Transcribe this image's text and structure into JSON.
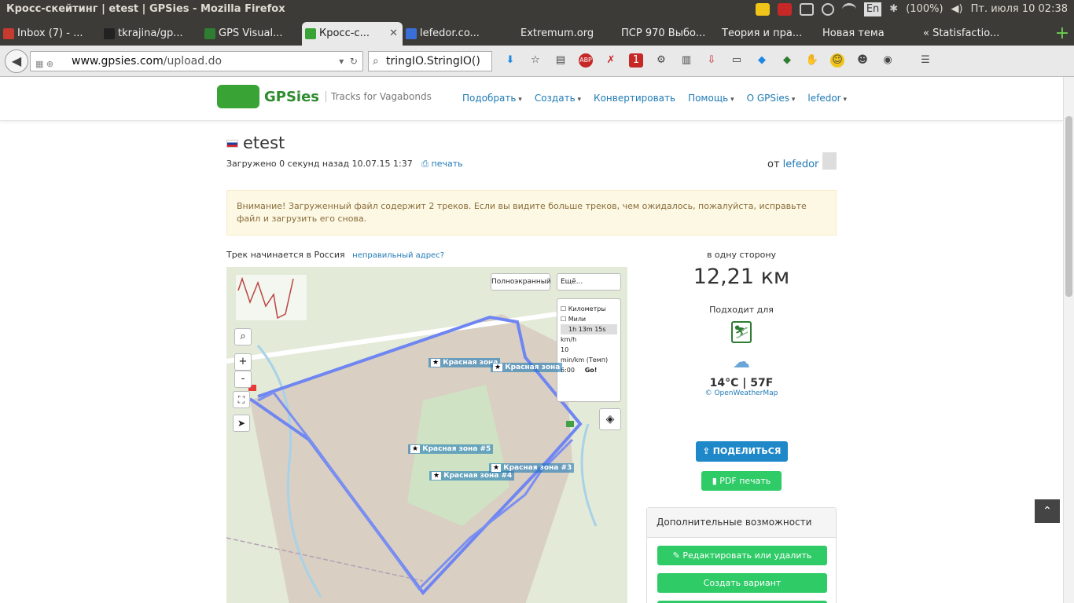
{
  "window": {
    "title": "Кросс-скейтинг | etest | GPSies - Mozilla Firefox"
  },
  "system": {
    "battery": "(100%)",
    "keyboard": "En",
    "clock": "Пт. июля 10 02:38"
  },
  "tabs": [
    {
      "label": "Inbox (7) - ...",
      "color": "#c63b2f"
    },
    {
      "label": "tkrajina/gp...",
      "color": "#222222"
    },
    {
      "label": "GPS Visual...",
      "color": "#2e7d32"
    },
    {
      "label": "Кросс-с...",
      "color": "#3aa335",
      "active": true
    },
    {
      "label": "lefedor.co...",
      "color": "#3a6fd8"
    },
    {
      "label": "Extremum.org",
      "color": ""
    },
    {
      "label": "ПСР 970 Выбо...",
      "color": ""
    },
    {
      "label": "Теория и пра...",
      "color": ""
    },
    {
      "label": "Новая тема",
      "color": ""
    },
    {
      "label": "« Statisfactio...",
      "color": ""
    }
  ],
  "nav": {
    "url_domain": "www.gpsies.com",
    "url_path": "/upload.do",
    "search_value": "tringIO.StringIO()"
  },
  "site": {
    "logo_name": "GPSies",
    "logo_tagline": "Tracks for Vagabonds",
    "menu": [
      "Подобрать",
      "Создать",
      "Конвертировать",
      "Помощь",
      "О GPSies",
      "lefedor"
    ]
  },
  "track": {
    "title": "etest",
    "uploaded": "Загружено 0 секунд назад 10.07.15 1:37",
    "print_label": "печать",
    "owner_prefix": "от",
    "owner": "lefedor"
  },
  "alert": {
    "text": "Внимание! Загруженный файл содержит 2 треков. Если вы видите больше треков, чем ожидалось, пожалуйста, исправьте файл и загрузить его снова."
  },
  "start": {
    "text": "Трек начинается в Россия",
    "link": "неправильный адрес?"
  },
  "map": {
    "fullscreen_label": "Полноэкранный",
    "more_label": "Ещё...",
    "km_label": "Километры",
    "miles_label": "Мили",
    "duration": "1h 13m 15s",
    "speed_unit": "km/h",
    "speed_value": "10",
    "pace_label": "min/km (Темп)",
    "pace_value": "6:00",
    "go_label": "Go!",
    "zones": [
      "Красная зона",
      "Красная зона",
      "Красная зона #5",
      "Красная зона #4",
      "Красная зона #3"
    ]
  },
  "side": {
    "direction": "в одну сторону",
    "distance": "12,21 км",
    "suitable": "Подходит для",
    "temperature": "14°C | 57F",
    "weather_credit": "© OpenWeatherMap",
    "share_label": "ПОДЕЛИТЬСЯ",
    "pdf_label": "PDF печать",
    "panel_title": "Дополнительные возможности",
    "edit_label": "Редактировать или удалить",
    "variant_label": "Создать вариант"
  }
}
